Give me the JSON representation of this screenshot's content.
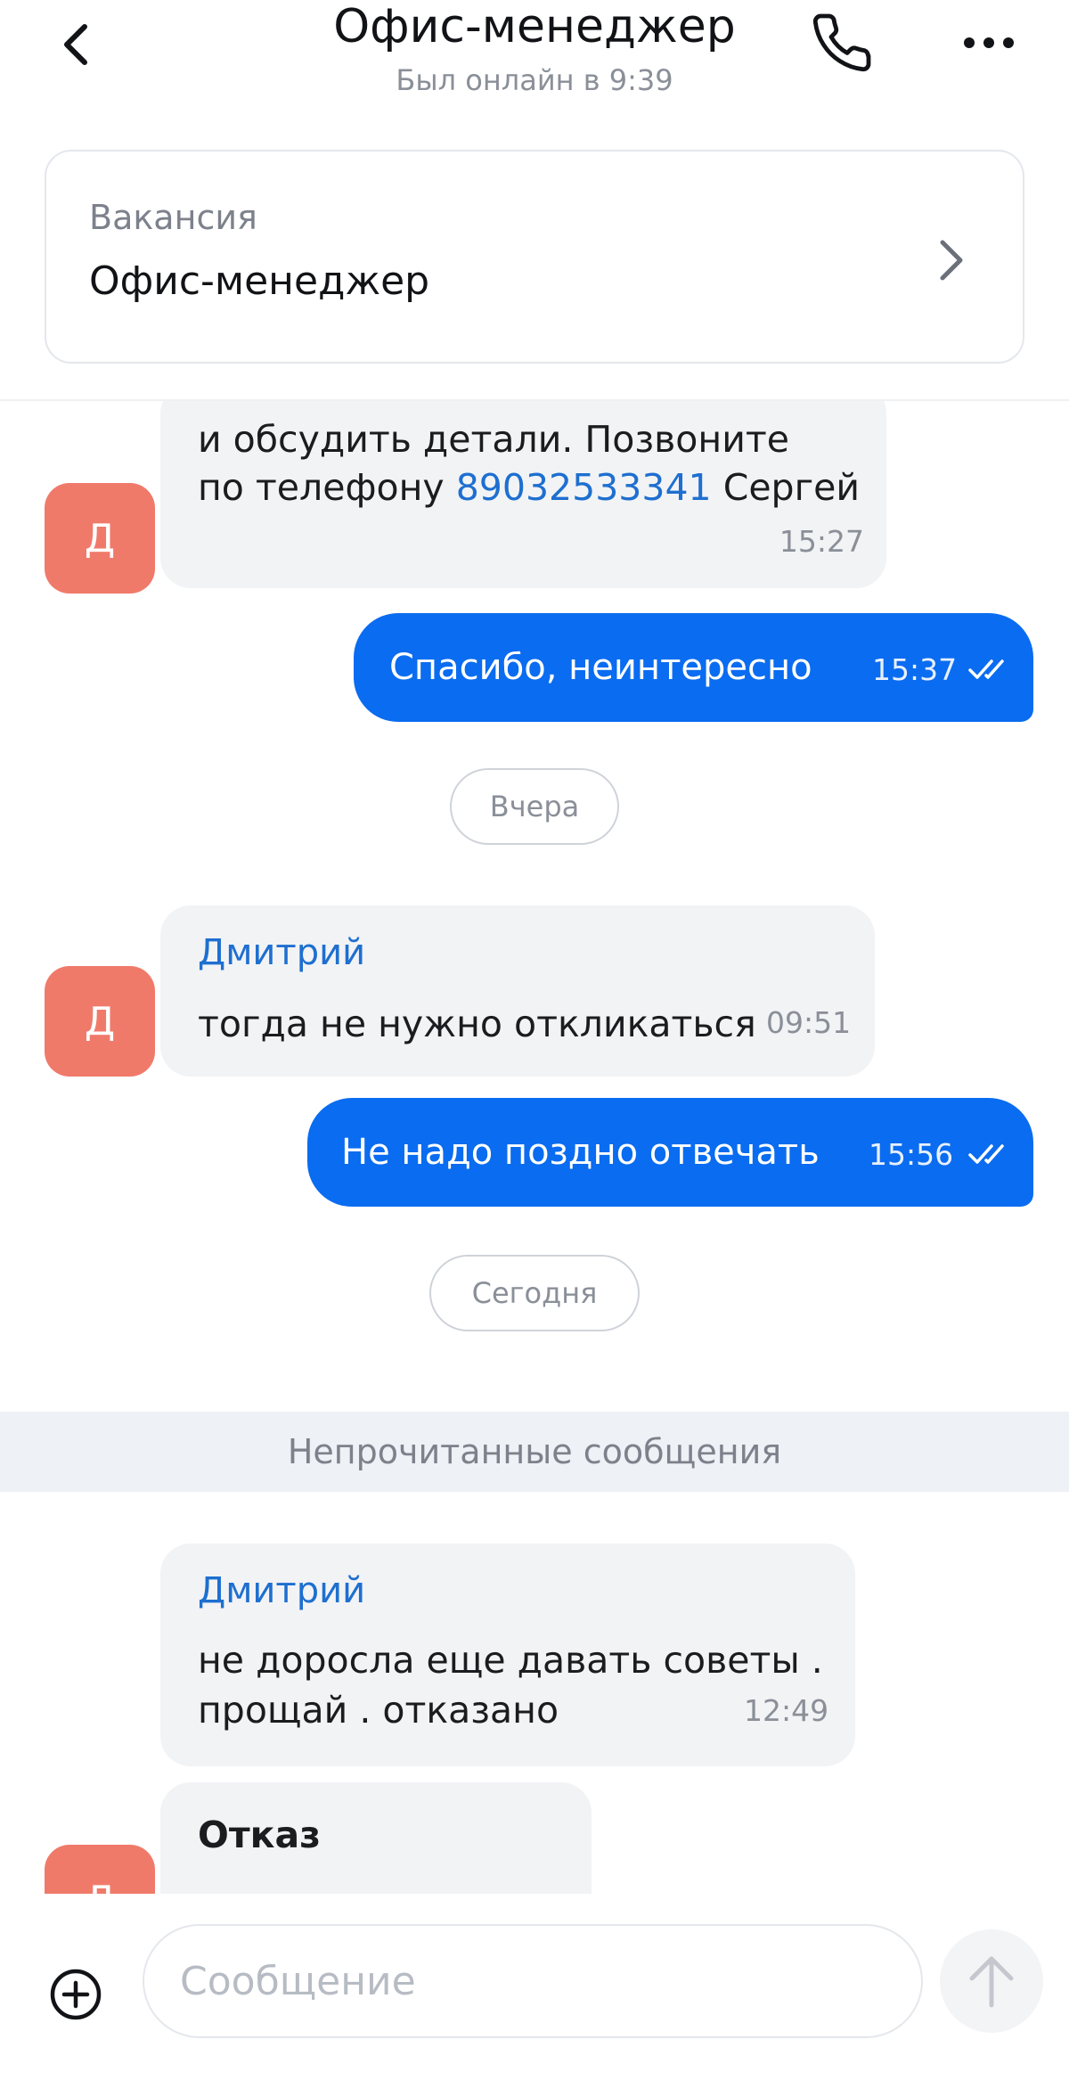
{
  "header": {
    "title": "Офис-менеджер",
    "status": "Был онлайн в 9:39",
    "icons": {
      "back": "chevron-left-icon",
      "call": "phone-icon",
      "more": "more-dots-icon"
    }
  },
  "vacancy": {
    "label": "Вакансия",
    "name": "Офис-менеджер"
  },
  "messages": {
    "m1": {
      "line1": "и обсудить детали. Позвоните",
      "line2_prefix": "по телефону ",
      "phone": "89032533341",
      "line2_suffix": " Сергей",
      "time": "15:27",
      "avatar": "Д"
    },
    "m2": {
      "text": "Спасибо, неинтересно",
      "time": "15:37"
    },
    "date1": "Вчера",
    "m3": {
      "sender": "Дмитрий",
      "text": "тогда не нужно откликаться",
      "time": "09:51",
      "avatar": "Д"
    },
    "m4": {
      "text": "Не надо поздно отвечать",
      "time": "15:56"
    },
    "date2": "Сегодня",
    "unread": "Непрочитанные сообщения",
    "m5": {
      "sender": "Дмитрий",
      "line1": "не доросла еще давать советы .",
      "line2": "прощай . отказано",
      "time": "12:49"
    },
    "m6": {
      "title": "Отказ",
      "avatar": "Д"
    }
  },
  "input": {
    "placeholder": "Сообщение",
    "icons": {
      "attach": "plus-circle-icon",
      "send": "arrow-up-icon"
    }
  },
  "colors": {
    "outgoing": "#0a6cf0",
    "incoming": "#f2f3f5",
    "avatar": "#f07a6a",
    "link": "#1e6fd0"
  }
}
